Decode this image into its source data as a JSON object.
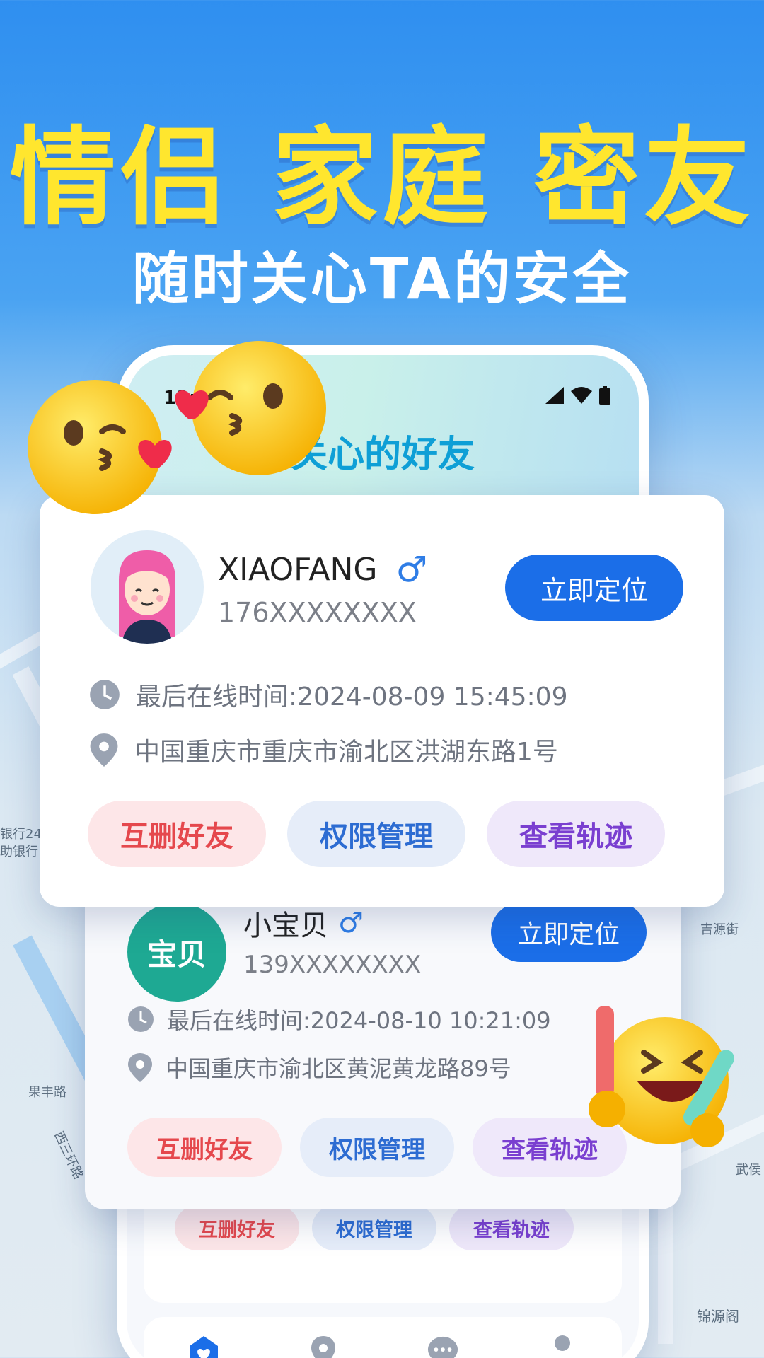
{
  "hero": {
    "headline": "情侣 家庭 密友",
    "subline": "随时关心TA的安全"
  },
  "map_labels": [
    "果丰路",
    "西三环路",
    "吉源街",
    "锦源阁",
    "武侯",
    "银行24",
    "助银行",
    "果丰路"
  ],
  "phone": {
    "status_time": "12:0",
    "title": "关心的好友",
    "bottom_card": {
      "actions": [
        "互删好友",
        "权限管理",
        "查看轨迹"
      ]
    },
    "tabs": [
      "home-heart-icon",
      "location-pin-icon",
      "chat-icon",
      "profile-icon"
    ]
  },
  "friends": [
    {
      "name": "XIAOFANG",
      "gender_symbol": "♂",
      "phone": "176XXXXXXXX",
      "locate_label": "立即定位",
      "last_online": "最后在线时间:2024-08-09 15:45:09",
      "address": "中国重庆市重庆市渝北区洪湖东路1号",
      "actions": [
        "互删好友",
        "权限管理",
        "查看轨迹"
      ]
    },
    {
      "name": "小宝贝",
      "avatar_text": "宝贝",
      "gender_symbol": "♂",
      "phone": "139XXXXXXXX",
      "locate_label": "立即定位",
      "last_online": "最后在线时间:2024-08-10 10:21:09",
      "address": "中国重庆市渝北区黄泥黄龙路89号",
      "actions": [
        "互删好友",
        "权限管理",
        "查看轨迹"
      ]
    }
  ],
  "colors": {
    "headline": "#ffe62e",
    "locate_button": "#1b6ee8",
    "pill_red": "#e5484d",
    "pill_blue": "#2d6cd2",
    "pill_purple": "#7a3fd0",
    "avatar_teal": "#1ea993"
  }
}
